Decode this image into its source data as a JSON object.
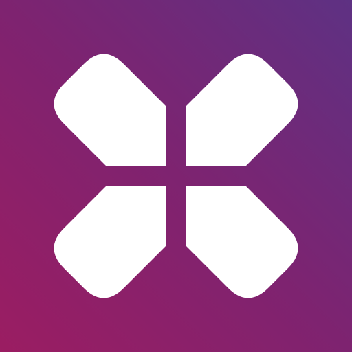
{
  "icon": {
    "semantic": "cross-logo-icon",
    "colors": {
      "gradient_start": "#9B1D62",
      "gradient_mid": "#7E2370",
      "gradient_end": "#5E3183",
      "glyph": "#FFFFFF"
    }
  }
}
